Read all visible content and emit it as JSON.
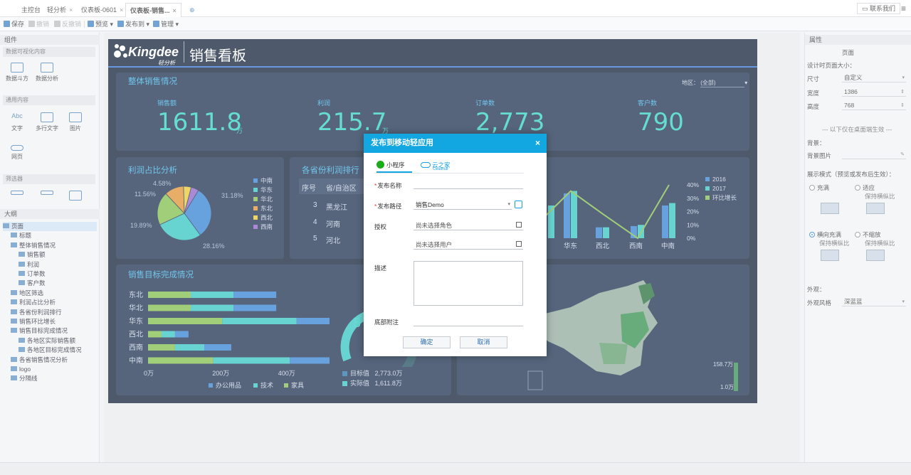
{
  "tabs": [
    {
      "label": "主控台",
      "closable": false
    },
    {
      "label": "轻分析",
      "closable": true
    },
    {
      "label": "仪表板-0601",
      "closable": true
    },
    {
      "label": "仪表板-销售...",
      "closable": true,
      "active": true
    }
  ],
  "contact": "联系我们",
  "toolbar": {
    "save": "保存",
    "undo": "撤销",
    "redo": "反撤销",
    "preview": "预览",
    "publish": "发布到",
    "manage": "管理"
  },
  "sidebar": {
    "header": "组件",
    "cat1": "数据可视化内容",
    "c_pivot": "数据斗方",
    "c_analysis": "数据分析",
    "cat2": "通用内容",
    "c_text": "文字",
    "c_multitext": "多行文字",
    "c_image": "图片",
    "c_web": "网页",
    "cat3": "筛选器",
    "outline_header": "大纲",
    "outline": [
      {
        "label": "页面",
        "level": 0
      },
      {
        "label": "标题",
        "level": 1
      },
      {
        "label": "整体销售情况",
        "level": 1
      },
      {
        "label": "销售额",
        "level": 2
      },
      {
        "label": "利润",
        "level": 2
      },
      {
        "label": "订单数",
        "level": 2
      },
      {
        "label": "客户数",
        "level": 2
      },
      {
        "label": "地区筛选",
        "level": 1
      },
      {
        "label": "利润占比分析",
        "level": 1
      },
      {
        "label": "各省份利润排行",
        "level": 1
      },
      {
        "label": "销售环比增长",
        "level": 1
      },
      {
        "label": "销售目标完成情况",
        "level": 1
      },
      {
        "label": "各地区实际销售额",
        "level": 2
      },
      {
        "label": "各地区目标完成情况",
        "level": 2
      },
      {
        "label": "各省销售情况分析",
        "level": 1
      },
      {
        "label": "logo",
        "level": 1
      },
      {
        "label": "分隔线",
        "level": 1
      }
    ]
  },
  "dashboard": {
    "brand": "Kingdee",
    "brand_sub": "轻分析",
    "title": "销售看板",
    "overall_title": "整体销售情况",
    "region_label": "地区：",
    "region_value": "(全部)",
    "kpis": [
      {
        "label": "销售额",
        "value": "1611.8",
        "unit": "万"
      },
      {
        "label": "利润",
        "value": "215.7",
        "unit": "万"
      },
      {
        "label": "订单数",
        "value": "2,773",
        "unit": ""
      },
      {
        "label": "客户数",
        "value": "790",
        "unit": ""
      }
    ],
    "profit_title": "利润占比分析",
    "province_title": "各省份利润排行",
    "province_headers": [
      "序号",
      "省/自治区"
    ],
    "province_rows": [
      {
        "rank": "3",
        "name": "黑龙江"
      },
      {
        "rank": "4",
        "name": "河南"
      },
      {
        "rank": "5",
        "name": "河北"
      }
    ],
    "target_title": "销售目标完成情况",
    "gauge_label": "5",
    "target_legend": [
      {
        "label": "目标值",
        "value": "2,773.0万"
      },
      {
        "label": "实际值",
        "value": "1,611.8万"
      }
    ],
    "map_legend_max": "158.7万",
    "map_legend_min": "1.0万"
  },
  "chart_data": [
    {
      "type": "pie",
      "categories": [
        "中南",
        "华东",
        "华北",
        "东北",
        "西北",
        "西南"
      ],
      "values": [
        31.18,
        28.16,
        19.89,
        11.56,
        4.58,
        4.63
      ],
      "data_labels": [
        "31.18%",
        "28.16%",
        "19.89%",
        "11.56%",
        "4.58%",
        ""
      ],
      "colors": [
        "#2f7fd1",
        "#2ec4c0",
        "#7dbb46",
        "#e08e2b",
        "#e8c62b",
        "#8b5cc8"
      ],
      "legend": "right"
    },
    {
      "type": "bar",
      "orientation": "horizontal",
      "stacked": true,
      "categories": [
        "东北",
        "华北",
        "华东",
        "西北",
        "西南",
        "中南"
      ],
      "series": [
        {
          "name": "办公用品",
          "values": [
            95,
            95,
            170,
            30,
            60,
            145
          ],
          "color": "#2f7fd1"
        },
        {
          "name": "技术",
          "values": [
            95,
            95,
            165,
            30,
            65,
            170
          ],
          "color": "#2ec4c0"
        },
        {
          "name": "家具",
          "values": [
            95,
            95,
            165,
            30,
            60,
            145
          ],
          "color": "#7dbb46"
        }
      ],
      "x_ticks": [
        "0万",
        "200万",
        "400万"
      ],
      "xlim": [
        0,
        500
      ],
      "legend": "bottom"
    },
    {
      "type": "bar",
      "categories": [
        "华东",
        "西北",
        "西南",
        "中南"
      ],
      "visible_categories_partial": [
        "",
        "华东",
        "西北",
        "西南",
        "中南"
      ],
      "series": [
        {
          "name": "2016",
          "values": [
            37,
            9,
            10,
            27
          ],
          "color": "#2f7fd1"
        },
        {
          "name": "2017",
          "values": [
            39,
            9,
            11,
            29
          ],
          "color": "#2ec4c0"
        },
        {
          "name": "环比增长",
          "type": "line",
          "values": [
            39,
            20,
            0,
            44
          ],
          "color": "#7dbb46"
        }
      ],
      "y2_ticks": [
        "0%",
        "10%",
        "20%",
        "30%",
        "40%"
      ],
      "legend": "top-right"
    }
  ],
  "modal": {
    "title": "发布到移动轻应用",
    "tab1": "小程序",
    "tab2": "云之家",
    "tab2_sub": "Cloudhub",
    "f_name": "发布名称",
    "f_path": "发布路径",
    "path_value": "销售Demo",
    "f_auth": "授权",
    "role_placeholder": "尚未选择角色",
    "user_placeholder": "尚未选择用户",
    "f_desc": "描述",
    "f_footer": "底部附注",
    "ok": "确定",
    "cancel": "取消"
  },
  "props": {
    "header": "属性",
    "section": "页面",
    "size_title": "设计时页面大小：",
    "size_label": "尺寸",
    "size_value": "自定义",
    "width_label": "宽度",
    "width_value": "1386",
    "height_label": "高度",
    "height_value": "768",
    "pc_note": "以下仅在桌面端生效",
    "bg_label": "背景：",
    "bg_image_label": "背景图片",
    "mode_title": "展示模式（预览或发布后生效）：",
    "mode_fill": "充满",
    "mode_fit": "适应",
    "mode_keep": "保持横纵比",
    "mode_horiz": "横向充满",
    "mode_none": "不缩放",
    "look_title": "外观：",
    "style_label": "外观风格",
    "style_value": "深蓝蓝"
  }
}
